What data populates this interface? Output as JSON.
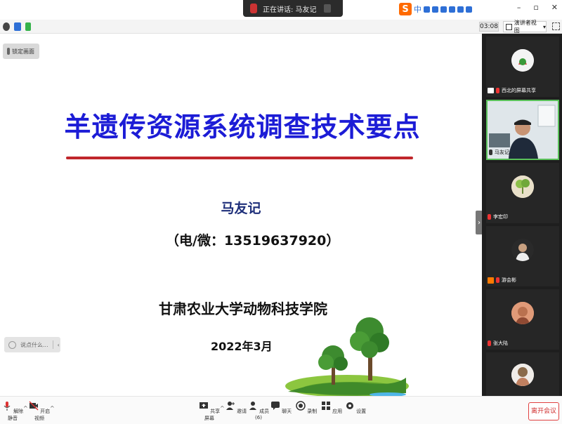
{
  "topbar": {
    "speaking_text": "正在讲话: 马友记",
    "ime_letter": "S",
    "ime_mode": "中"
  },
  "meeting_bar": {
    "timer": "03:08",
    "view_label": "演讲者视图"
  },
  "slide": {
    "lock_label": "锁定画面",
    "title": "羊遗传资源系统调查技术要点",
    "author": "马友记",
    "contact": "（电/微：13519637920）",
    "institution": "甘肃农业大学动物科技学院",
    "date": "2022年3月",
    "raise_hand_label": "说点什么..."
  },
  "participants": [
    {
      "name": "西北的屏幕共享"
    },
    {
      "name": "马友记"
    },
    {
      "name": "李宏印"
    },
    {
      "name": "游会彬"
    },
    {
      "name": "张大陆"
    },
    {
      "name": ""
    }
  ],
  "toolbar": {
    "mute": "解除静音",
    "video": "开启视频",
    "share": "共享屏幕",
    "invite": "邀请",
    "members": "成员(6)",
    "chat": "聊天",
    "record": "录制",
    "apps": "应用",
    "settings": "设置",
    "leave": "离开会议"
  },
  "colors": {
    "title_blue": "#1c1cd6",
    "rule_red": "#c0262b",
    "active_speaker": "#5bc25b",
    "leave_red": "#d03030"
  }
}
